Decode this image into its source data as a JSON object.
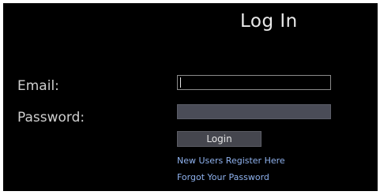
{
  "login_form": {
    "title": "Log In",
    "email_label": "Email:",
    "email_value": "",
    "password_label": "Password:",
    "password_value": "",
    "login_button_label": "Login",
    "register_link": "New Users Register Here",
    "forgot_link": "Forgot Your Password"
  },
  "colors": {
    "background": "#000000",
    "outer_border": "#ffffff",
    "text": "#cfcfcf",
    "link": "#8fb2ee",
    "password_field": "#4a4c57",
    "button": "#45464e"
  }
}
